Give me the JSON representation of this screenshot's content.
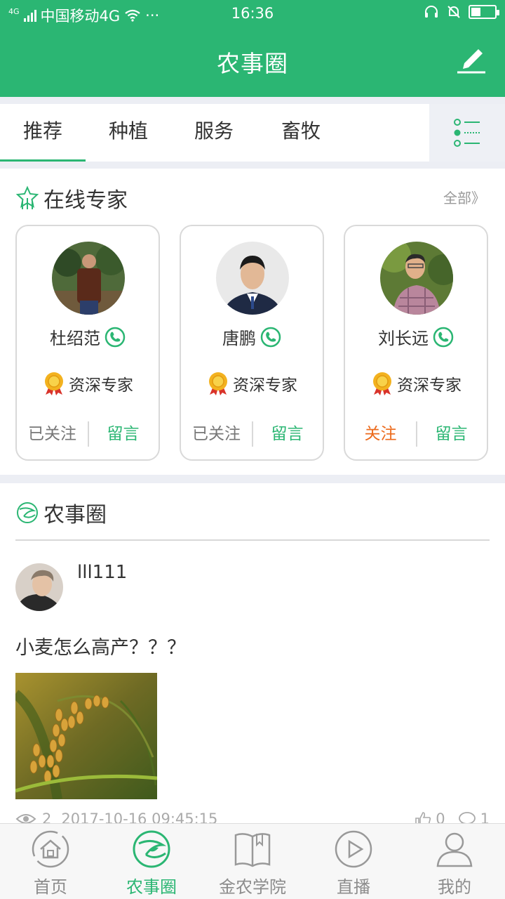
{
  "status": {
    "network": "4G",
    "carrier": "中国移动4G",
    "dots": "···",
    "time": "16:36",
    "battery_level": 0.4
  },
  "header": {
    "title": "农事圈",
    "edit_icon": "pencil-icon"
  },
  "tabs": [
    {
      "label": "推荐",
      "active": true
    },
    {
      "label": "种植",
      "active": false
    },
    {
      "label": "服务",
      "active": false
    },
    {
      "label": "畜牧",
      "active": false
    }
  ],
  "experts": {
    "title": "在线专家",
    "more": "全部》",
    "cards": [
      {
        "name": "杜绍范",
        "level": "资深专家",
        "follow": "已关注",
        "message": "留言",
        "followed": true
      },
      {
        "name": "唐鹏",
        "level": "资深专家",
        "follow": "已关注",
        "message": "留言",
        "followed": true
      },
      {
        "name": "刘长远",
        "level": "资深专家",
        "follow": "关注",
        "message": "留言",
        "followed": false
      }
    ]
  },
  "feed": {
    "title": "农事圈",
    "post": {
      "username": "lll111",
      "text": "小麦怎么高产？？？",
      "views": "2",
      "timestamp": "2017-10-16 09:45:15",
      "likes": "0",
      "comments": "1"
    }
  },
  "bottom_nav": [
    {
      "label": "首页",
      "icon": "home-icon",
      "active": false
    },
    {
      "label": "农事圈",
      "icon": "circle-icon",
      "active": true
    },
    {
      "label": "金农学院",
      "icon": "book-icon",
      "active": false
    },
    {
      "label": "直播",
      "icon": "play-icon",
      "active": false
    },
    {
      "label": "我的",
      "icon": "user-icon",
      "active": false
    }
  ],
  "colors": {
    "brand": "#2bb673",
    "follow": "#ec6a1c",
    "divider": "#eceef4"
  }
}
